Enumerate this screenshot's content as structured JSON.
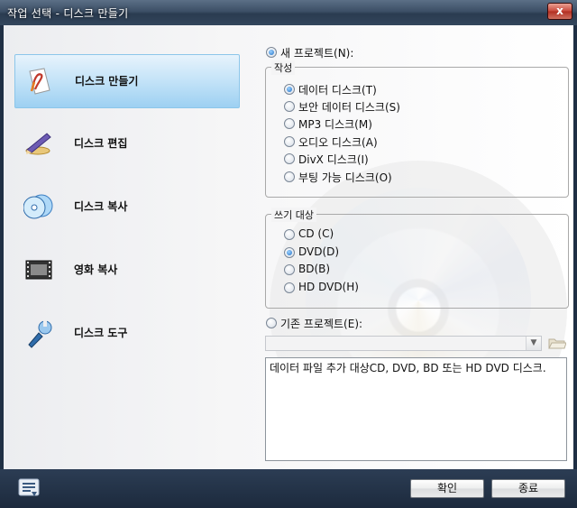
{
  "window": {
    "title": "작업 선택 - 디스크 만들기",
    "close_glyph": "x"
  },
  "nav": {
    "items": [
      {
        "label": "디스크 만들기",
        "icon": "create-disc-icon",
        "selected": true
      },
      {
        "label": "디스크 편집",
        "icon": "edit-disc-icon",
        "selected": false
      },
      {
        "label": "디스크 복사",
        "icon": "copy-disc-icon",
        "selected": false
      },
      {
        "label": "영화 복사",
        "icon": "film-copy-icon",
        "selected": false
      },
      {
        "label": "디스크 도구",
        "icon": "disc-tools-icon",
        "selected": false
      }
    ]
  },
  "new_project": {
    "label": "새 프로젝트(N):",
    "selected": true
  },
  "compose_group": {
    "title": "작성",
    "options": [
      {
        "label": "데이터 디스크(T)",
        "selected": true
      },
      {
        "label": "보안 데이터 디스크(S)",
        "selected": false
      },
      {
        "label": "MP3 디스크(M)",
        "selected": false
      },
      {
        "label": "오디오 디스크(A)",
        "selected": false
      },
      {
        "label": "DivX 디스크(I)",
        "selected": false
      },
      {
        "label": "부팅 가능 디스크(O)",
        "selected": false
      }
    ]
  },
  "target_group": {
    "title": "쓰기 대상",
    "options": [
      {
        "label": "CD (C)",
        "selected": false
      },
      {
        "label": "DVD(D)",
        "selected": true
      },
      {
        "label": "BD(B)",
        "selected": false
      },
      {
        "label": "HD DVD(H)",
        "selected": false
      }
    ]
  },
  "existing_project": {
    "label": "기존 프로젝트(E):",
    "selected": false,
    "combo_value": ""
  },
  "description": "데이터 파일 추가 대상CD, DVD, BD 또는 HD DVD 디스크.",
  "buttons": {
    "ok": "확인",
    "exit": "종료"
  },
  "colors": {
    "accent": "#1e6fc6",
    "selection": "#bfe1f7",
    "bottom_bar": "#22324a"
  }
}
